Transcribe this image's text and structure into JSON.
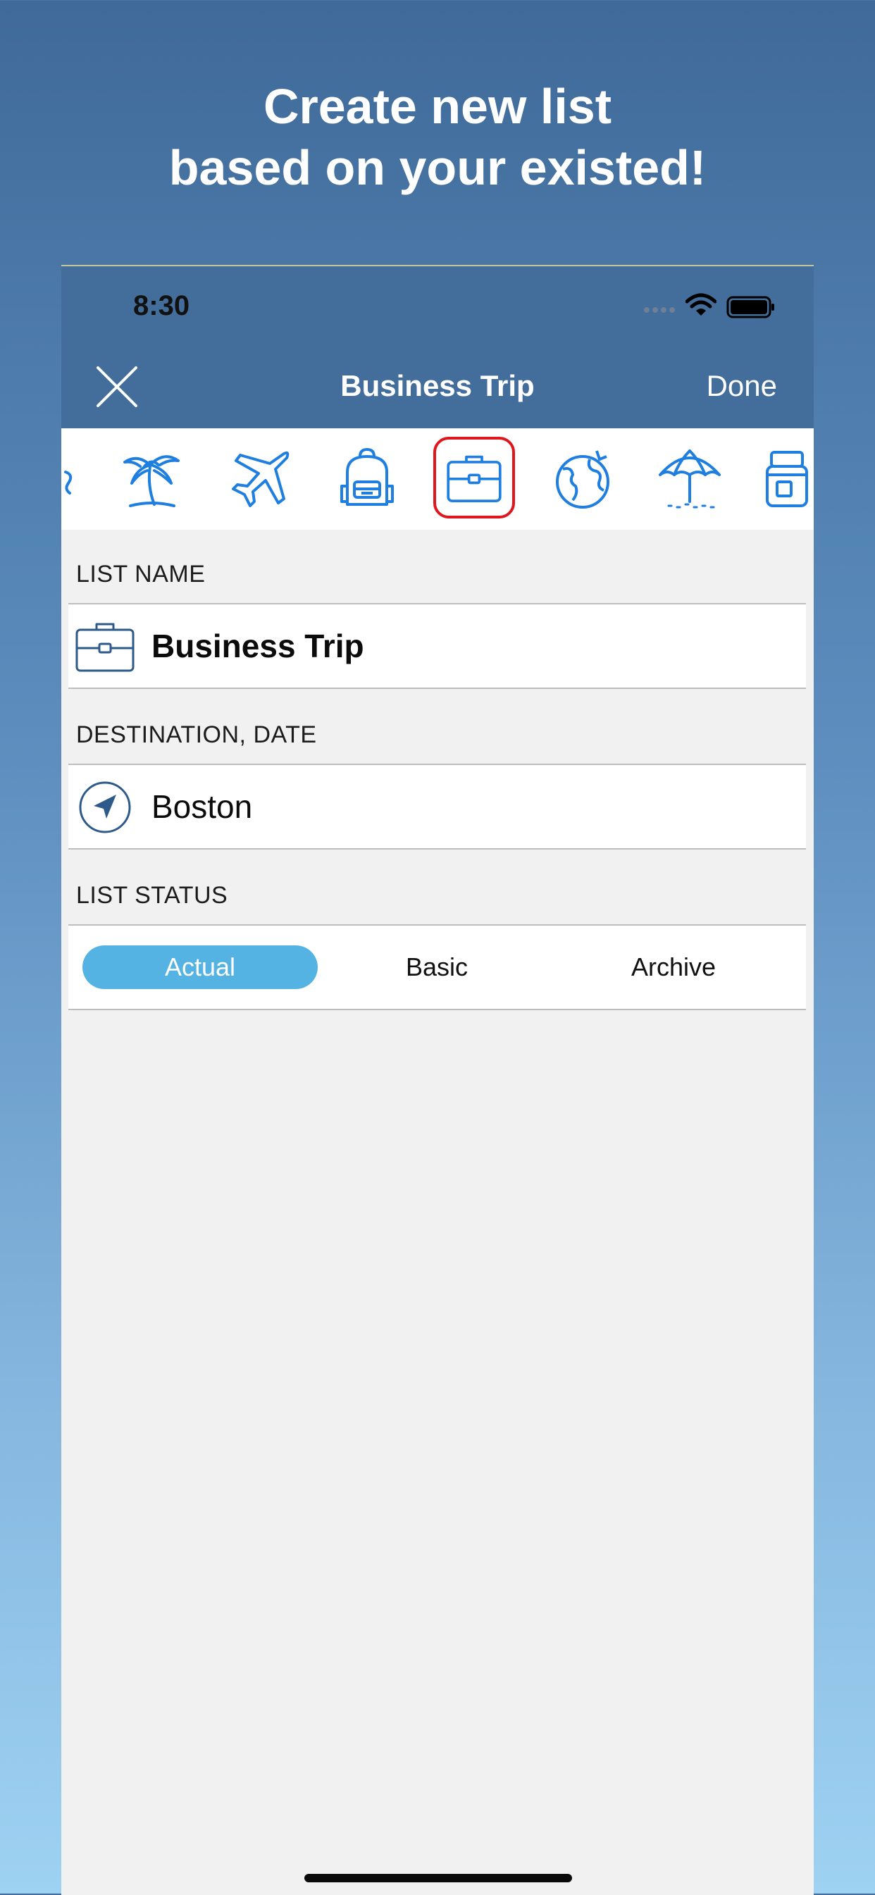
{
  "promo": {
    "line1": "Create new list",
    "line2": "based on your existed!"
  },
  "status_bar": {
    "time": "8:30",
    "icons": [
      "signal-icon",
      "wifi-icon",
      "battery-icon"
    ]
  },
  "nav": {
    "close_icon": "close-icon",
    "title": "Business Trip",
    "done_label": "Done"
  },
  "icon_strip": {
    "icons": [
      "partial-icon",
      "palm-tree-icon",
      "airplane-icon",
      "backpack-icon",
      "briefcase-icon",
      "globe-icon",
      "beach-umbrella-icon",
      "suitcase-icon"
    ],
    "selected": "briefcase-icon"
  },
  "list_name": {
    "header": "LIST NAME",
    "icon": "briefcase-icon",
    "value": "Business Trip"
  },
  "destination": {
    "header": "DESTINATION, DATE",
    "icon": "location-arrow-icon",
    "value": "Boston"
  },
  "list_status": {
    "header": "LIST STATUS",
    "options": [
      "Actual",
      "Basic",
      "Archive"
    ],
    "selected": "Actual"
  },
  "colors": {
    "nav_bar": "#436d9b",
    "icon_blue": "#1f7fe0",
    "selection_border": "#e0161d",
    "segment_active": "#54b3e2",
    "dark_icon": "#2d5a8a"
  }
}
